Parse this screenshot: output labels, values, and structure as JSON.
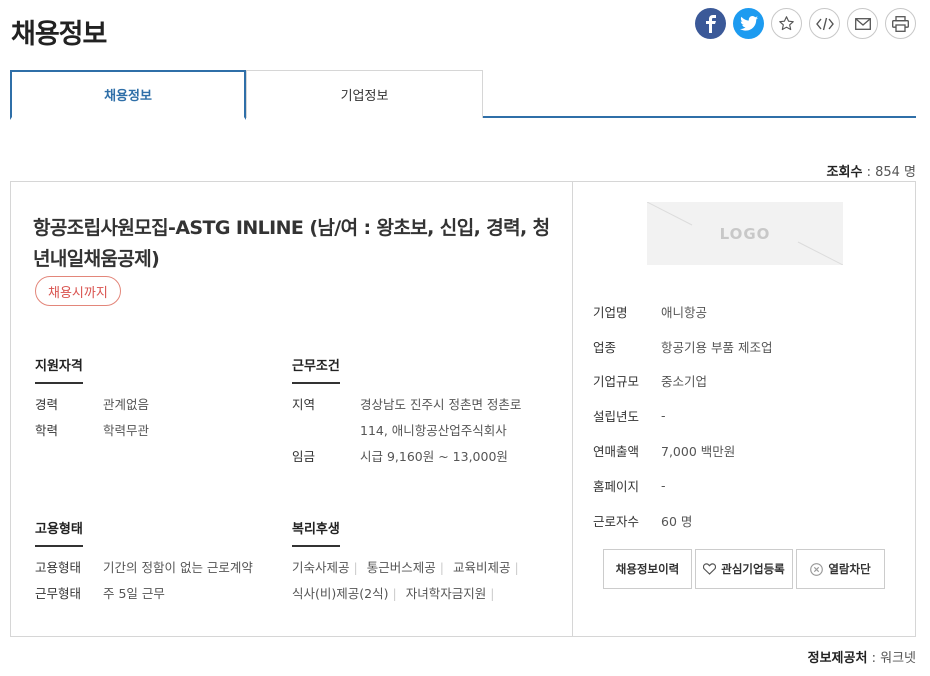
{
  "page_title": "채용정보",
  "share": {
    "facebook": "facebook-icon",
    "twitter": "twitter-icon",
    "favorite": "star-icon",
    "embed": "code-icon",
    "email": "mail-icon",
    "print": "printer-icon"
  },
  "tabs": [
    {
      "label": "채용정보",
      "active": true
    },
    {
      "label": "기업정보",
      "active": false
    }
  ],
  "views": {
    "label": "조회수",
    "value": "854 명"
  },
  "job": {
    "title": "항공조립사원모집-ASTG INLINE (남/여 : 왕초보, 신입, 경력, 청년내일채움공제)",
    "deadline": "채용시까지"
  },
  "qualification": {
    "heading": "지원자격",
    "rows": [
      {
        "k": "경력",
        "v": "관계없음"
      },
      {
        "k": "학력",
        "v": "학력무관"
      }
    ]
  },
  "conditions": {
    "heading": "근무조건",
    "rows": [
      {
        "k": "지역",
        "v": "경상남도 진주시 정촌면 정촌로 114, 애니항공산업주식회사"
      },
      {
        "k": "임금",
        "v": "시급 9,160원 ~ 13,000원"
      }
    ]
  },
  "employment": {
    "heading": "고용형태",
    "rows": [
      {
        "k": "고용형태",
        "v": "기간의 정함이 없는 근로계약"
      },
      {
        "k": "근무형태",
        "v": "주 5일 근무"
      }
    ]
  },
  "benefits": {
    "heading": "복리후생",
    "items": [
      "기숙사제공",
      "통근버스제공",
      "교육비제공",
      "식사(비)제공(2식)",
      "자녀학자금지원"
    ]
  },
  "company": {
    "logo_text": "LOGO",
    "rows": [
      {
        "k": "기업명",
        "v": "애니항공"
      },
      {
        "k": "업종",
        "v": "항공기용 부품 제조업"
      },
      {
        "k": "기업규모",
        "v": "중소기업"
      },
      {
        "k": "설립년도",
        "v": "-"
      },
      {
        "k": "연매출액",
        "v": "7,000 백만원"
      },
      {
        "k": "홈페이지",
        "v": "-"
      },
      {
        "k": "근로자수",
        "v": "60 명"
      }
    ]
  },
  "actions": {
    "history": "채용정보이력",
    "interest": "관심기업등록",
    "block": "열람차단"
  },
  "source": {
    "label": "정보제공처",
    "value": "워크넷"
  },
  "colors": {
    "accent": "#2f6fa8",
    "deadline": "#d9534f",
    "facebook": "#3b5998",
    "twitter": "#1d9bf0"
  }
}
